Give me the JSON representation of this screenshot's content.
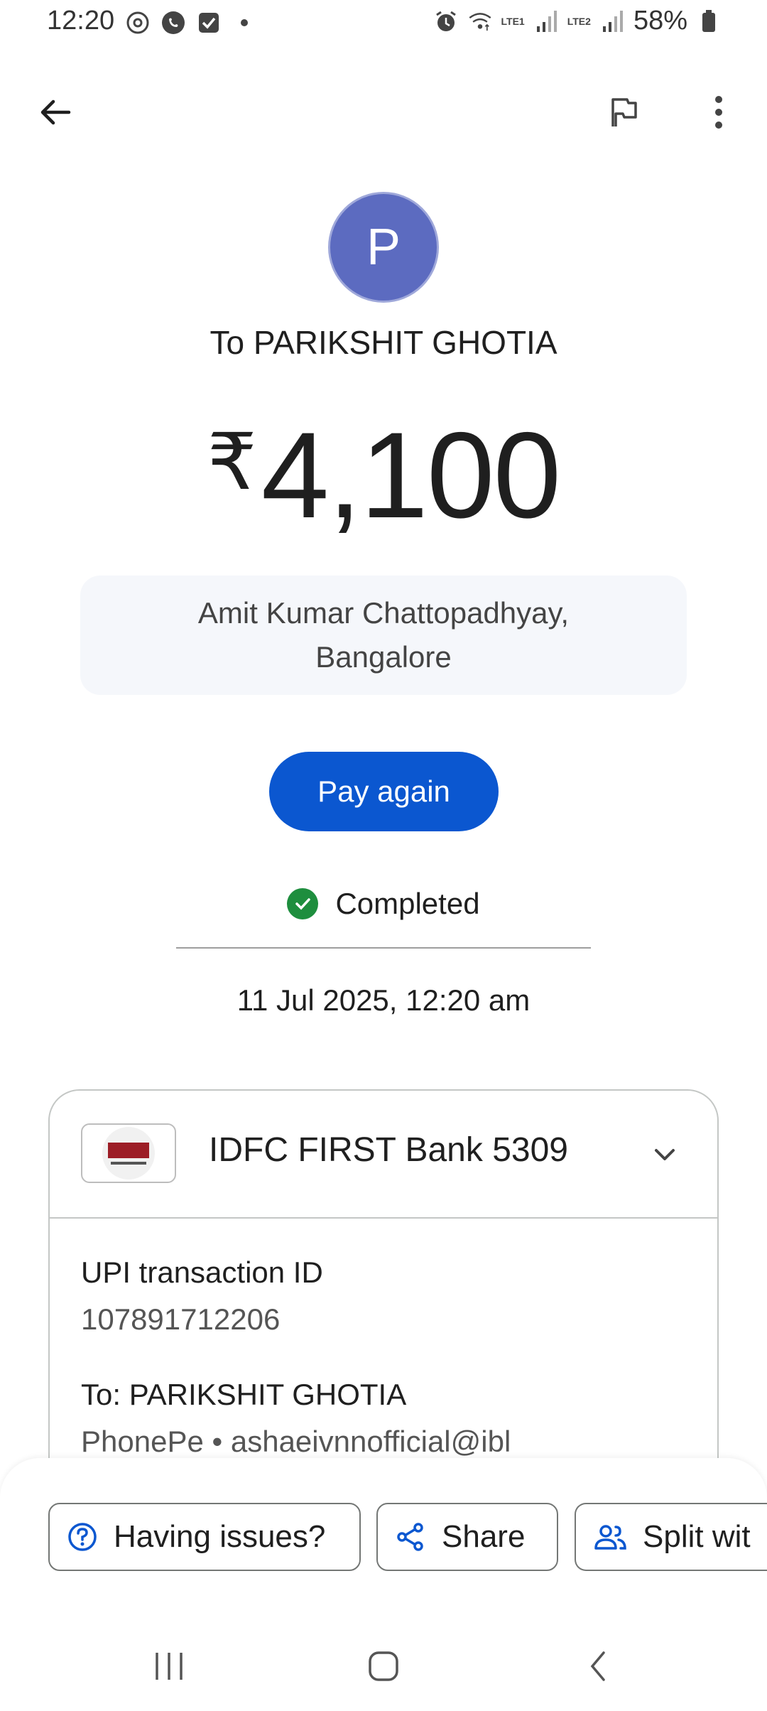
{
  "status_bar": {
    "time": "12:20",
    "battery": "58%",
    "sim1": "LTE1",
    "sim2": "LTE2",
    "icons_left": [
      "location-icon",
      "whatsapp-icon",
      "checkbox-icon",
      "dot-icon"
    ],
    "icons_right": [
      "alarm-icon",
      "wifi-icon",
      "signal-icon",
      "signal-icon",
      "battery-icon"
    ]
  },
  "app_bar": {
    "back_icon": "arrow-back-icon",
    "flag_icon": "flag-icon",
    "more_icon": "more-vert-icon"
  },
  "transaction": {
    "avatar_letter": "P",
    "avatar_color": "#5c6bc0",
    "recipient_line": "To PARIKSHIT GHOTIA",
    "currency_symbol": "₹",
    "amount": "4,100",
    "note_line1": "Amit Kumar Chattopadhyay,",
    "note_line2": "Bangalore",
    "pay_again_label": "Pay again",
    "status": "Completed",
    "status_color": "#1e8e3e",
    "datetime": "11 Jul 2025, 12:20 am"
  },
  "card": {
    "bank_name": "IDFC FIRST Bank 5309",
    "upi_label": "UPI transaction ID",
    "upi_value": "107891712206",
    "to_label": "To: PARIKSHIT GHOTIA",
    "to_value": "PhonePe • ashaeivnnofficial@ibl"
  },
  "actions": {
    "issues_label": "Having issues?",
    "share_label": "Share",
    "split_label": "Split wit"
  },
  "colors": {
    "primary": "#0b57d0",
    "accent_icon": "#0b57d0"
  }
}
